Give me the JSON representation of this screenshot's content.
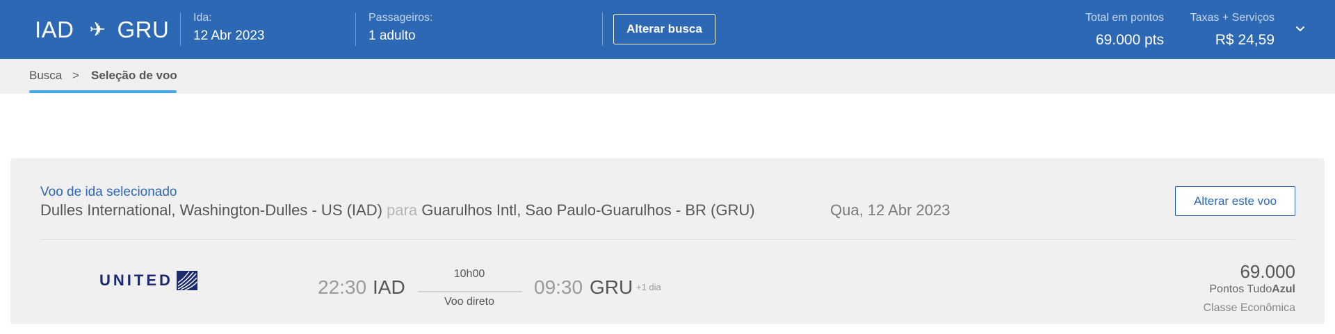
{
  "header": {
    "origin": "IAD",
    "plane_glyph": "✈",
    "destination": "GRU",
    "ida_label": "Ida:",
    "ida_value": "12 Abr 2023",
    "passengers_label": "Passageiros:",
    "passengers_value": "1 adulto",
    "change_search_label": "Alterar busca",
    "total_points_label": "Total em pontos",
    "total_points_value": "69.000 pts",
    "taxes_label": "Taxas + Serviços",
    "taxes_value": "R$ 24,59"
  },
  "breadcrumb": {
    "items": [
      "Busca",
      "Seleção de voo"
    ],
    "separator": ">"
  },
  "selected_flight": {
    "title": "Voo de ida selecionado",
    "origin_airport": "Dulles International, Washington-Dulles - US (IAD)",
    "connector": "para",
    "destination_airport": "Guarulhos Intl, Sao Paulo-Guarulhos - BR (GRU)",
    "date": "Qua, 12 Abr 2023",
    "change_flight_label": "Alterar este voo",
    "airline_logo_text": "UNITED",
    "departure_time": "22:30",
    "departure_code": "IAD",
    "duration": "10h00",
    "stops": "Voo direto",
    "arrival_time": "09:30",
    "arrival_code": "GRU",
    "day_offset": "+1 dia",
    "points": "69.000",
    "points_label_prefix": "Pontos Tudo",
    "points_label_bold": "Azul",
    "cabin": "Classe Econômica"
  },
  "colors": {
    "header_bg": "#2d68b4",
    "accent_underline": "#47a9e3",
    "card_bg": "#f0f0f0",
    "united_navy": "#1a2a6c"
  },
  "icons": {
    "plane": "airplane-icon",
    "expand": "chevron-down-icon",
    "airline": "united-globe-icon"
  }
}
